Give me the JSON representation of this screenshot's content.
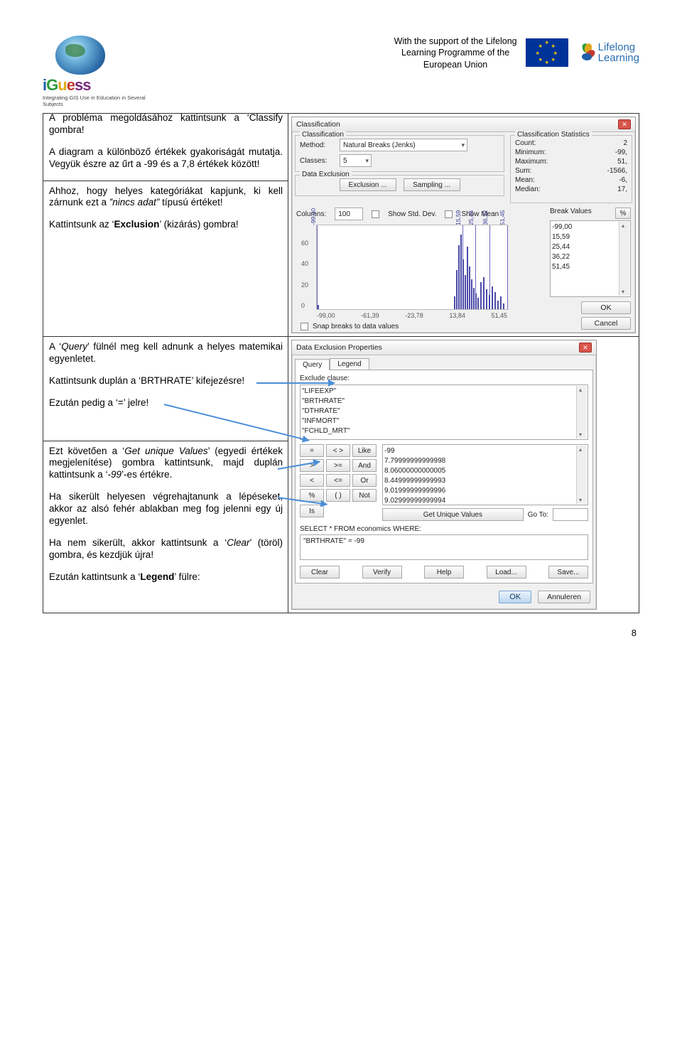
{
  "header": {
    "logo_name_i": "i",
    "logo_name_g": "G",
    "logo_name_u": "u",
    "logo_name_e": "e",
    "logo_name_s1": "s",
    "logo_name_s2": "s",
    "logo_sub": "Integrating GIS Use in Education in Several Subjects",
    "eu_line1": "With the support of the Lifelong",
    "eu_line2": "Learning Programme of the",
    "eu_line3": "European Union",
    "lifelong1": "Lifelong",
    "lifelong2": "Learning"
  },
  "cells": {
    "c1p1": "A probléma megoldásához kattintsunk a ‘Classify gombra!",
    "c1p2": "A diagram a különböző értékek gyakoriságát mutatja. Vegyük észre az űrt a -99 és a 7,8 értékek között!",
    "c2p1a": "Ahhoz, hogy helyes kategóriákat kapjunk, ki kell zárnunk ezt a ",
    "c2p1b": "‟nincs adat”",
    "c2p1c": " típusú értéket!",
    "c2p2": "Kattintsunk az ‘Exclusion’ (kizárás) gombra!",
    "c3p1a": "A ‘",
    "c3p1b": "Query",
    "c3p1c": "’ fülnél meg kell adnunk a helyes matemikai egyenletet.",
    "c3p2": "Kattintsunk duplán a ‘BRTHRATE’ kifejezésre!",
    "c3p3": "Ezután pedig a ‘=’ jelre!",
    "c4p1a": "Ezt követően a ‘",
    "c4p1b": "Get unique Values",
    "c4p1c": "’ (egyedi értékek megjelenítése) gombra kattintsunk, majd duplán kattintsunk a ‘",
    "c4p1d": "-99",
    "c4p1e": "’-es értékre.",
    "c4p2": "Ha sikerült helyesen végrehajtanunk a lépéseket, akkor az alsó fehér ablakban meg fog jelenni egy új egyenlet.",
    "c4p3a": "Ha nem sikerült, akkor kattintsunk a ‘",
    "c4p3b": "Clear",
    "c4p3c": "’ (töröl) gombra, és kezdjük újra!",
    "c4p4": "Ezután kattintsunk a ‘Legend’ fülre:"
  },
  "classification": {
    "dlg_title": "Classification",
    "grp_classification": "Classification",
    "lbl_method": "Method:",
    "val_method": "Natural Breaks (Jenks)",
    "lbl_classes": "Classes:",
    "val_classes": "5",
    "grp_stats": "Classification Statistics",
    "stat_count_l": "Count:",
    "stat_count_v": "2",
    "stat_min_l": "Minimum:",
    "stat_min_v": "-99,",
    "stat_max_l": "Maximum:",
    "stat_max_v": "51,",
    "stat_sum_l": "Sum:",
    "stat_sum_v": "-1566,",
    "stat_mean_l": "Mean:",
    "stat_mean_v": "-6,",
    "stat_med_l": "Median:",
    "stat_med_v": "17,",
    "grp_dataexcl": "Data Exclusion",
    "btn_exclusion": "Exclusion ...",
    "btn_sampling": "Sampling ...",
    "lbl_columns": "Columns:",
    "val_columns": "100",
    "chk_std": "Show Std. Dev.",
    "chk_mean": "Show Mean",
    "grp_breakvals": "Break Values",
    "bv1": "-99,00",
    "bv2": "15,59",
    "bv3": "25,44",
    "bv4": "36,22",
    "bv5": "51,45",
    "pct": "%",
    "chk_snap": "Snap breaks to data values",
    "btn_ok": "OK",
    "btn_cancel": "Cancel",
    "xaxis": [
      "-99,00",
      "-61,39",
      "-23,78",
      "13,84",
      "51,45"
    ],
    "yaxis": [
      "",
      "60",
      "40",
      "20",
      "0"
    ],
    "toplabels": [
      "-99,00",
      "15,59",
      "25,44",
      "36,22",
      "51,45"
    ]
  },
  "dep": {
    "dlg_title": "Data Exclusion Properties",
    "tab_query": "Query",
    "tab_legend": "Legend",
    "lbl_exclude": "Exclude clause:",
    "fields": [
      "\"LIFEEXP\"",
      "\"BRTHRATE\"",
      "\"DTHRATE\"",
      "\"INFMORT\"",
      "\"FCHLD_MRT\""
    ],
    "ops": [
      "=",
      "< >",
      "Like",
      ">",
      ">=",
      "And",
      "<",
      "<=",
      "Or",
      "%",
      "( )",
      "Not"
    ],
    "op_is": "Is",
    "values": [
      "-99",
      "7.79999999999998",
      "8.06000000000005",
      "8.44999999999993",
      "9.01999999999996",
      "9.02999999999994"
    ],
    "btn_getunique": "Get Unique Values",
    "lbl_goto": "Go To:",
    "lbl_select": "SELECT * FROM economics WHERE:",
    "expr": "\"BRTHRATE\" = -99",
    "btn_clear": "Clear",
    "btn_verify": "Verify",
    "btn_help": "Help",
    "btn_load": "Load...",
    "btn_save": "Save...",
    "btn_ok": "OK",
    "btn_ann": "Annuleren"
  },
  "page_number": "8"
}
